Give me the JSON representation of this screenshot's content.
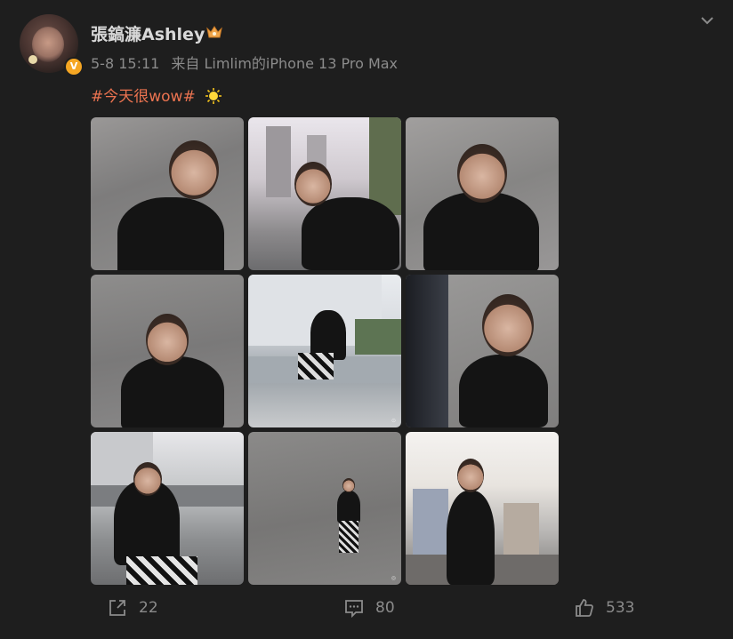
{
  "post": {
    "author": "張鎬濂Ashley",
    "verified_badge": "V",
    "meta": {
      "time": "5-8 15:11",
      "source": "来自 Limlim的iPhone 13 Pro Max"
    },
    "text": {
      "hashtag": "#今天很wow#",
      "emoji_icon": "sun-icon"
    },
    "photos": [
      {
        "name": "photo-1"
      },
      {
        "name": "photo-2"
      },
      {
        "name": "photo-3"
      },
      {
        "name": "photo-4"
      },
      {
        "name": "photo-5"
      },
      {
        "name": "photo-6"
      },
      {
        "name": "photo-7"
      },
      {
        "name": "photo-8"
      },
      {
        "name": "photo-9"
      }
    ]
  },
  "actions": {
    "share_count": "22",
    "comment_count": "80",
    "like_count": "533"
  },
  "colors": {
    "background": "#1e1e1e",
    "hashtag": "#eb7350",
    "verified": "#f5a623",
    "meta_text": "#8b8b8b"
  }
}
